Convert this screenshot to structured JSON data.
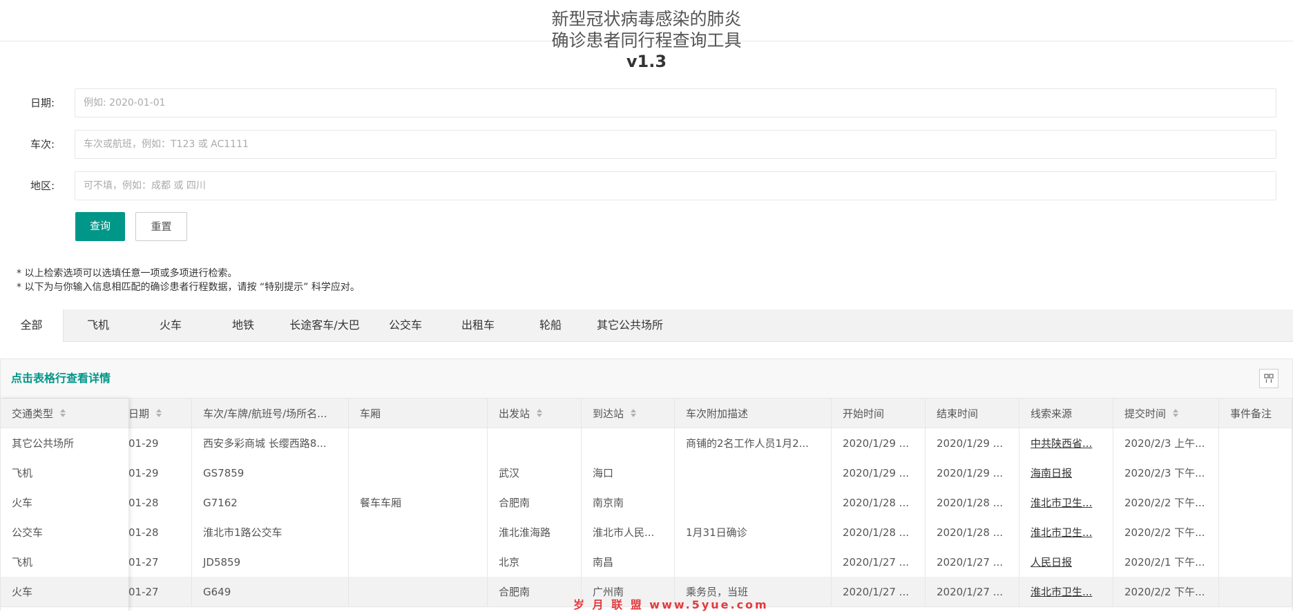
{
  "header": {
    "title_line1": "新型冠状病毒感染的肺炎",
    "title_line2": "确诊患者同行程查询工具",
    "version": "v1.3"
  },
  "form": {
    "date_label": "日期:",
    "date_placeholder": "例如: 2020-01-01",
    "train_label": "车次:",
    "train_placeholder": "车次或航班，例如：T123 或 AC1111",
    "region_label": "地区:",
    "region_placeholder": "可不填，例如：成都 或 四川",
    "search_button": "查询",
    "reset_button": "重置"
  },
  "notes": [
    "* 以上检索选项可以选填任意一项或多项进行检索。",
    "* 以下为与你输入信息相匹配的确诊患者行程数据，请按 “特别提示” 科学应对。"
  ],
  "tabs": [
    "全部",
    "飞机",
    "火车",
    "地铁",
    "长途客车/大巴",
    "公交车",
    "出租车",
    "轮船",
    "其它公共场所"
  ],
  "table": {
    "toolbar_title": "点击表格行查看详情",
    "columns_icon": "columns-icon",
    "headers": [
      "交通类型",
      "日期",
      "车次/车牌/航班号/场所名...",
      "车厢",
      "出发站",
      "到达站",
      "车次附加描述",
      "开始时间",
      "结束时间",
      "线索来源",
      "提交时间",
      "事件备注"
    ],
    "rows": [
      [
        "其它公共场所",
        "01-29",
        "西安多彩商城 长缨西路8...",
        "",
        "",
        "",
        "商铺的2名工作人员1月2...",
        "2020/1/29 ...",
        "2020/1/29 ...",
        "中共陕西省...",
        "2020/2/3 上午...",
        ""
      ],
      [
        "飞机",
        "01-29",
        "GS7859",
        "",
        "武汉",
        "海口",
        "",
        "2020/1/29 ...",
        "2020/1/29 ...",
        "海南日报",
        "2020/2/3 下午...",
        ""
      ],
      [
        "火车",
        "01-28",
        "G7162",
        "餐车车厢",
        "合肥南",
        "南京南",
        "",
        "2020/1/28 ...",
        "2020/1/28 ...",
        "淮北市卫生...",
        "2020/2/2 下午...",
        ""
      ],
      [
        "公交车",
        "01-28",
        "淮北市1路公交车",
        "",
        "淮北淮海路",
        "淮北市人民...",
        "1月31日确诊",
        "2020/1/28 ...",
        "2020/1/28 ...",
        "淮北市卫生...",
        "2020/2/2 下午...",
        ""
      ],
      [
        "飞机",
        "01-27",
        "JD5859",
        "",
        "北京",
        "南昌",
        "",
        "2020/1/27 ...",
        "2020/1/27 ...",
        "人民日报",
        "2020/2/1 下午...",
        ""
      ],
      [
        "火车",
        "01-27",
        "G649",
        "",
        "合肥南",
        "广州南",
        "乘务员，当班",
        "2020/1/27 ...",
        "2020/1/27 ...",
        "淮北市卫生...",
        "2020/2/2 下午...",
        ""
      ]
    ]
  },
  "watermark": "岁 月 联 盟  www.5yue.com",
  "colors": {
    "primary": "#009688",
    "tab_bg": "#f2f2f2",
    "watermark": "#e4393c"
  }
}
